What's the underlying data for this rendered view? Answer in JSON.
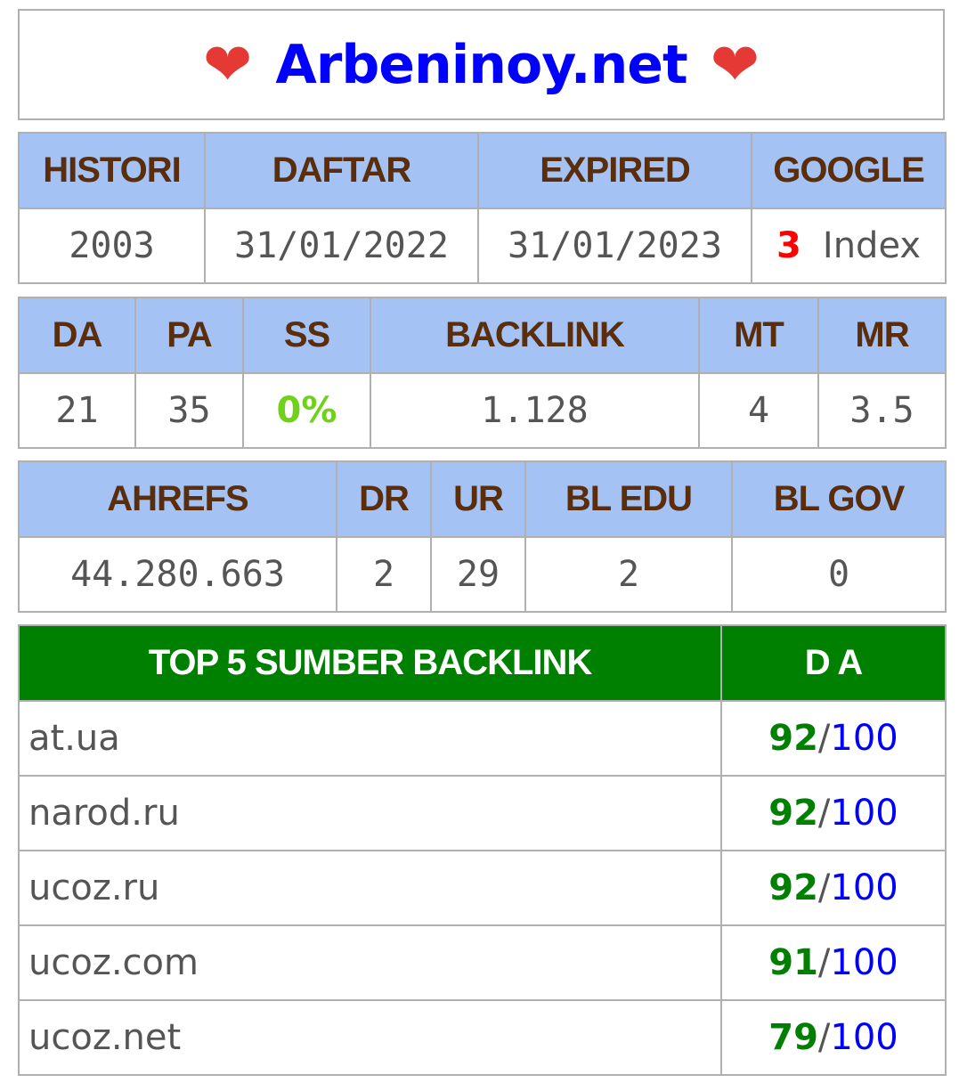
{
  "site": {
    "title": "Arbeninoy.net",
    "heart": "❤"
  },
  "table1": {
    "headers": [
      "HISTORI",
      "DAFTAR",
      "EXPIRED",
      "GOOGLE"
    ],
    "values": {
      "histori": "2003",
      "daftar": "31/01/2022",
      "expired": "31/01/2023",
      "google_count": "3",
      "google_label": "Index"
    }
  },
  "table2": {
    "headers": [
      "DA",
      "PA",
      "SS",
      "BACKLINK",
      "MT",
      "MR"
    ],
    "values": {
      "da": "21",
      "pa": "35",
      "ss": "0%",
      "backlink": "1.128",
      "mt": "4",
      "mr": "3.5"
    }
  },
  "table3": {
    "headers": [
      "AHREFS",
      "DR",
      "UR",
      "BL EDU",
      "BL GOV"
    ],
    "values": {
      "ahrefs": "44.280.663",
      "dr": "2",
      "ur": "29",
      "bl_edu": "2",
      "bl_gov": "0"
    }
  },
  "top_backlinks": {
    "header_source": "TOP 5 SUMBER BACKLINK",
    "header_da": "D A",
    "separator": "/",
    "max": "100",
    "rows": [
      {
        "source": "at.ua",
        "da": "92"
      },
      {
        "source": "narod.ru",
        "da": "92"
      },
      {
        "source": "ucoz.ru",
        "da": "92"
      },
      {
        "source": "ucoz.com",
        "da": "91"
      },
      {
        "source": "ucoz.net",
        "da": "79"
      }
    ]
  }
}
